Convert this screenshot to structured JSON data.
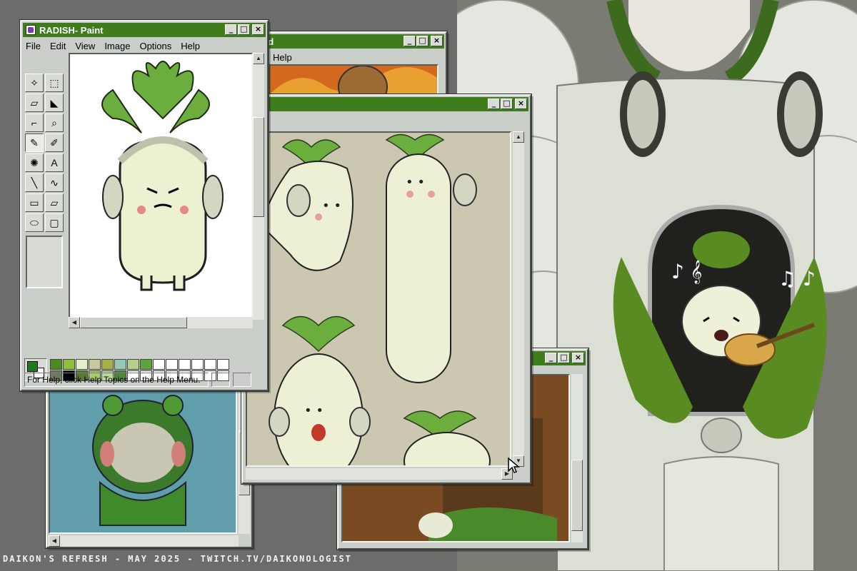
{
  "windows": {
    "paint": {
      "title": "RADISH- Paint",
      "menu": [
        "File",
        "Edit",
        "View",
        "Image",
        "Options",
        "Help"
      ],
      "status": "For Help, click Help Topics on the Help Menu.",
      "tools": [
        "free-select",
        "rect-select",
        "eraser",
        "fill",
        "eyedropper",
        "magnifier",
        "pencil",
        "brush",
        "airbrush",
        "text",
        "line",
        "curve",
        "rectangle",
        "polygon",
        "ellipse",
        "rounded-rect"
      ],
      "tool_glyphs": [
        "✧",
        "⬚",
        "▱",
        "◣",
        "⌐",
        "⌕",
        "✎",
        "✐",
        "✺",
        "A",
        "╲",
        "∿",
        "▭",
        "▱",
        "⬭",
        "▢"
      ],
      "active_tool_index": 6,
      "foreground_color": "#1c7c1a",
      "background_color": "#ffffff",
      "palette": [
        "#4a8a1e",
        "#8fbf3a",
        "#e6f0c8",
        "#c8c89a",
        "#a8b04a",
        "#96c8b4",
        "#b4d08c",
        "#5aa53c",
        "#ffffff",
        "#ffffff",
        "#ffffff",
        "#ffffff",
        "#ffffff",
        "#ffffff",
        "#6e7a5a",
        "#000000",
        "#5a7a32",
        "#a8cc6c",
        "#bcd89a",
        "#4c8a3a",
        "#ffffff",
        "#ffffff",
        "#ffffff",
        "#ffffff",
        "#ffffff",
        "#ffffff",
        "#ffffff",
        "#ffffff"
      ]
    },
    "notepad": {
      "title": "ad",
      "menu": [
        "Help"
      ]
    },
    "sketches": {
      "title": ""
    },
    "frog": {
      "title": ""
    },
    "brown": {
      "title": ""
    }
  },
  "footer": "Daikon's Refresh - May 2025 - twitch.tv/daikonologist",
  "colors": {
    "titlebar": "#3f7d1c",
    "desktop": "#6c6c6a"
  }
}
